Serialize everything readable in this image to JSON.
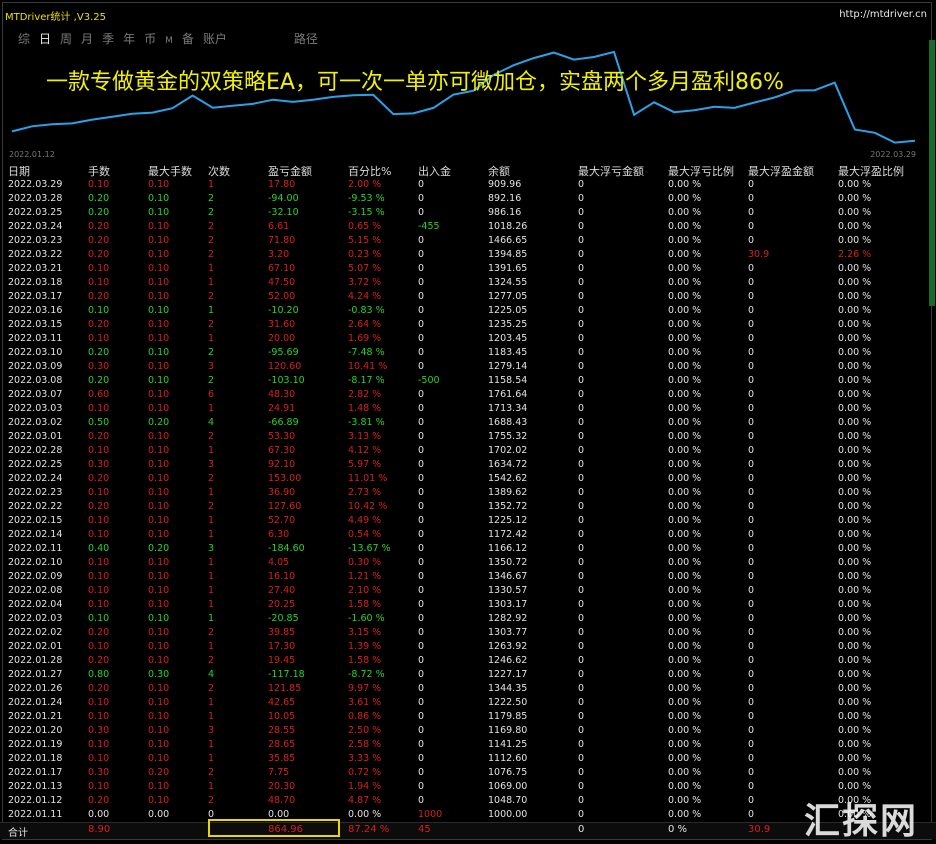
{
  "app": {
    "title": "MTDriver统计 ,V3.25",
    "url": "http://mtdriver.cn"
  },
  "tabs": [
    {
      "label": "综",
      "active": false
    },
    {
      "label": "日",
      "active": true
    },
    {
      "label": "周",
      "active": false
    },
    {
      "label": "月",
      "active": false
    },
    {
      "label": "季",
      "active": false
    },
    {
      "label": "年",
      "active": false
    },
    {
      "label": "币",
      "active": false
    },
    {
      "label": "M",
      "active": false
    },
    {
      "label": "备",
      "active": false
    },
    {
      "label": "账户",
      "active": false
    },
    {
      "label": "路径",
      "active": false
    }
  ],
  "headline": "一款专做黄金的双策略EA，可一次一单亦可微加仓，实盘两个多月盈利86%",
  "chart_dates": {
    "start": "2022.01.12",
    "end": "2022.03.29"
  },
  "colors": {
    "profit": "#d42020",
    "loss": "#28d228",
    "headline": "#f2f200",
    "line": "#2aa2e8"
  },
  "chart_data": {
    "type": "line",
    "title": "",
    "xlabel": "",
    "ylabel": "",
    "x": [
      "2022.01.11",
      "2022.01.12",
      "2022.01.13",
      "2022.01.17",
      "2022.01.18",
      "2022.01.19",
      "2022.01.20",
      "2022.01.21",
      "2022.01.24",
      "2022.01.26",
      "2022.01.27",
      "2022.01.28",
      "2022.02.01",
      "2022.02.02",
      "2022.02.03",
      "2022.02.04",
      "2022.02.08",
      "2022.02.09",
      "2022.02.10",
      "2022.02.11",
      "2022.02.14",
      "2022.02.15",
      "2022.02.22",
      "2022.02.23",
      "2022.02.24",
      "2022.02.25",
      "2022.02.28",
      "2022.03.01",
      "2022.03.02",
      "2022.03.03",
      "2022.03.07",
      "2022.03.08",
      "2022.03.09",
      "2022.03.10",
      "2022.03.11",
      "2022.03.15",
      "2022.03.16",
      "2022.03.17",
      "2022.03.18",
      "2022.03.21",
      "2022.03.22",
      "2022.03.23",
      "2022.03.24",
      "2022.03.25",
      "2022.03.28",
      "2022.03.29"
    ],
    "series": [
      {
        "values": [
          1000.0,
          1048.7,
          1069.0,
          1076.75,
          1112.6,
          1141.25,
          1169.8,
          1179.85,
          1222.5,
          1344.35,
          1227.17,
          1246.62,
          1263.92,
          1303.77,
          1282.92,
          1303.17,
          1330.57,
          1346.67,
          1350.72,
          1166.12,
          1172.42,
          1225.12,
          1352.72,
          1389.62,
          1542.62,
          1634.72,
          1702.02,
          1755.32,
          1688.43,
          1713.34,
          1761.64,
          1158.54,
          1279.14,
          1183.45,
          1203.45,
          1235.25,
          1225.05,
          1277.05,
          1324.55,
          1391.65,
          1394.85,
          1466.65,
          1018.26,
          986.16,
          892.16,
          909.96
        ]
      }
    ]
  },
  "table": {
    "headers": [
      "日期",
      "手数",
      "最大手数",
      "次数",
      "盈亏金额",
      "百分比%",
      "出入金",
      "余额",
      "最大浮亏金额",
      "最大浮亏比例",
      "最大浮盈金额",
      "最大浮盈比例"
    ],
    "rows": [
      [
        "2022.03.29",
        "0.10",
        "0.10",
        "1",
        "17.80",
        "2.00 %",
        "0",
        "909.96",
        "0",
        "0.00 %",
        "0",
        "0.00 %"
      ],
      [
        "2022.03.28",
        "0.20",
        "0.10",
        "2",
        "-94.00",
        "-9.53 %",
        "0",
        "892.16",
        "0",
        "0.00 %",
        "0",
        "0.00 %"
      ],
      [
        "2022.03.25",
        "0.20",
        "0.10",
        "2",
        "-32.10",
        "-3.15 %",
        "0",
        "986.16",
        "0",
        "0.00 %",
        "0",
        "0.00 %"
      ],
      [
        "2022.03.24",
        "0.20",
        "0.10",
        "2",
        "6.61",
        "0.65 %",
        "-455",
        "1018.26",
        "0",
        "0.00 %",
        "0",
        "0.00 %"
      ],
      [
        "2022.03.23",
        "0.20",
        "0.10",
        "2",
        "71.80",
        "5.15 %",
        "0",
        "1466.65",
        "0",
        "0.00 %",
        "0",
        "0.00 %"
      ],
      [
        "2022.03.22",
        "0.20",
        "0.10",
        "2",
        "3.20",
        "0.23 %",
        "0",
        "1394.85",
        "0",
        "0.00 %",
        "30.9",
        "2.26 %"
      ],
      [
        "2022.03.21",
        "0.10",
        "0.10",
        "1",
        "67.10",
        "5.07 %",
        "0",
        "1391.65",
        "0",
        "0.00 %",
        "0",
        "0.00 %"
      ],
      [
        "2022.03.18",
        "0.10",
        "0.10",
        "1",
        "47.50",
        "3.72 %",
        "0",
        "1324.55",
        "0",
        "0.00 %",
        "0",
        "0.00 %"
      ],
      [
        "2022.03.17",
        "0.20",
        "0.10",
        "2",
        "52.00",
        "4.24 %",
        "0",
        "1277.05",
        "0",
        "0.00 %",
        "0",
        "0.00 %"
      ],
      [
        "2022.03.16",
        "0.10",
        "0.10",
        "1",
        "-10.20",
        "-0.83 %",
        "0",
        "1225.05",
        "0",
        "0.00 %",
        "0",
        "0.00 %"
      ],
      [
        "2022.03.15",
        "0.20",
        "0.10",
        "2",
        "31.60",
        "2.64 %",
        "0",
        "1235.25",
        "0",
        "0.00 %",
        "0",
        "0.00 %"
      ],
      [
        "2022.03.11",
        "0.10",
        "0.10",
        "1",
        "20.00",
        "1.69 %",
        "0",
        "1203.45",
        "0",
        "0.00 %",
        "0",
        "0.00 %"
      ],
      [
        "2022.03.10",
        "0.20",
        "0.10",
        "2",
        "-95.69",
        "-7.48 %",
        "0",
        "1183.45",
        "0",
        "0.00 %",
        "0",
        "0.00 %"
      ],
      [
        "2022.03.09",
        "0.30",
        "0.10",
        "3",
        "120.60",
        "10.41 %",
        "0",
        "1279.14",
        "0",
        "0.00 %",
        "0",
        "0.00 %"
      ],
      [
        "2022.03.08",
        "0.20",
        "0.10",
        "2",
        "-103.10",
        "-8.17 %",
        "-500",
        "1158.54",
        "0",
        "0.00 %",
        "0",
        "0.00 %"
      ],
      [
        "2022.03.07",
        "0.60",
        "0.10",
        "6",
        "48.30",
        "2.82 %",
        "0",
        "1761.64",
        "0",
        "0.00 %",
        "0",
        "0.00 %"
      ],
      [
        "2022.03.03",
        "0.10",
        "0.10",
        "1",
        "24.91",
        "1.48 %",
        "0",
        "1713.34",
        "0",
        "0.00 %",
        "0",
        "0.00 %"
      ],
      [
        "2022.03.02",
        "0.50",
        "0.20",
        "4",
        "-66.89",
        "-3.81 %",
        "0",
        "1688.43",
        "0",
        "0.00 %",
        "0",
        "0.00 %"
      ],
      [
        "2022.03.01",
        "0.20",
        "0.10",
        "2",
        "53.30",
        "3.13 %",
        "0",
        "1755.32",
        "0",
        "0.00 %",
        "0",
        "0.00 %"
      ],
      [
        "2022.02.28",
        "0.10",
        "0.10",
        "1",
        "67.30",
        "4.12 %",
        "0",
        "1702.02",
        "0",
        "0.00 %",
        "0",
        "0.00 %"
      ],
      [
        "2022.02.25",
        "0.30",
        "0.10",
        "3",
        "92.10",
        "5.97 %",
        "0",
        "1634.72",
        "0",
        "0.00 %",
        "0",
        "0.00 %"
      ],
      [
        "2022.02.24",
        "0.20",
        "0.10",
        "2",
        "153.00",
        "11.01 %",
        "0",
        "1542.62",
        "0",
        "0.00 %",
        "0",
        "0.00 %"
      ],
      [
        "2022.02.23",
        "0.10",
        "0.10",
        "1",
        "36.90",
        "2.73 %",
        "0",
        "1389.62",
        "0",
        "0.00 %",
        "0",
        "0.00 %"
      ],
      [
        "2022.02.22",
        "0.20",
        "0.10",
        "2",
        "127.60",
        "10.42 %",
        "0",
        "1352.72",
        "0",
        "0.00 %",
        "0",
        "0.00 %"
      ],
      [
        "2022.02.15",
        "0.10",
        "0.10",
        "1",
        "52.70",
        "4.49 %",
        "0",
        "1225.12",
        "0",
        "0.00 %",
        "0",
        "0.00 %"
      ],
      [
        "2022.02.14",
        "0.10",
        "0.10",
        "1",
        "6.30",
        "0.54 %",
        "0",
        "1172.42",
        "0",
        "0.00 %",
        "0",
        "0.00 %"
      ],
      [
        "2022.02.11",
        "0.40",
        "0.20",
        "3",
        "-184.60",
        "-13.67 %",
        "0",
        "1166.12",
        "0",
        "0.00 %",
        "0",
        "0.00 %"
      ],
      [
        "2022.02.10",
        "0.10",
        "0.10",
        "1",
        "4.05",
        "0.30 %",
        "0",
        "1350.72",
        "0",
        "0.00 %",
        "0",
        "0.00 %"
      ],
      [
        "2022.02.09",
        "0.10",
        "0.10",
        "1",
        "16.10",
        "1.21 %",
        "0",
        "1346.67",
        "0",
        "0.00 %",
        "0",
        "0.00 %"
      ],
      [
        "2022.02.08",
        "0.10",
        "0.10",
        "1",
        "27.40",
        "2.10 %",
        "0",
        "1330.57",
        "0",
        "0.00 %",
        "0",
        "0.00 %"
      ],
      [
        "2022.02.04",
        "0.10",
        "0.10",
        "1",
        "20.25",
        "1.58 %",
        "0",
        "1303.17",
        "0",
        "0.00 %",
        "0",
        "0.00 %"
      ],
      [
        "2022.02.03",
        "0.10",
        "0.10",
        "1",
        "-20.85",
        "-1.60 %",
        "0",
        "1282.92",
        "0",
        "0.00 %",
        "0",
        "0.00 %"
      ],
      [
        "2022.02.02",
        "0.20",
        "0.10",
        "2",
        "39.85",
        "3.15 %",
        "0",
        "1303.77",
        "0",
        "0.00 %",
        "0",
        "0.00 %"
      ],
      [
        "2022.02.01",
        "0.10",
        "0.10",
        "1",
        "17.30",
        "1.39 %",
        "0",
        "1263.92",
        "0",
        "0.00 %",
        "0",
        "0.00 %"
      ],
      [
        "2022.01.28",
        "0.20",
        "0.10",
        "2",
        "19.45",
        "1.58 %",
        "0",
        "1246.62",
        "0",
        "0.00 %",
        "0",
        "0.00 %"
      ],
      [
        "2022.01.27",
        "0.80",
        "0.30",
        "4",
        "-117.18",
        "-8.72 %",
        "0",
        "1227.17",
        "0",
        "0.00 %",
        "0",
        "0.00 %"
      ],
      [
        "2022.01.26",
        "0.20",
        "0.10",
        "2",
        "121.85",
        "9.97 %",
        "0",
        "1344.35",
        "0",
        "0.00 %",
        "0",
        "0.00 %"
      ],
      [
        "2022.01.24",
        "0.10",
        "0.10",
        "1",
        "42.65",
        "3.61 %",
        "0",
        "1222.50",
        "0",
        "0.00 %",
        "0",
        "0.00 %"
      ],
      [
        "2022.01.21",
        "0.10",
        "0.10",
        "1",
        "10.05",
        "0.86 %",
        "0",
        "1179.85",
        "0",
        "0.00 %",
        "0",
        "0.00 %"
      ],
      [
        "2022.01.20",
        "0.30",
        "0.10",
        "3",
        "28.55",
        "2.50 %",
        "0",
        "1169.80",
        "0",
        "0.00 %",
        "0",
        "0.00 %"
      ],
      [
        "2022.01.19",
        "0.10",
        "0.10",
        "1",
        "28.65",
        "2.58 %",
        "0",
        "1141.25",
        "0",
        "0.00 %",
        "0",
        "0.00 %"
      ],
      [
        "2022.01.18",
        "0.10",
        "0.10",
        "1",
        "35.85",
        "3.33 %",
        "0",
        "1112.60",
        "0",
        "0.00 %",
        "0",
        "0.00 %"
      ],
      [
        "2022.01.17",
        "0.30",
        "0.20",
        "2",
        "7.75",
        "0.72 %",
        "0",
        "1076.75",
        "0",
        "0.00 %",
        "0",
        "0.00 %"
      ],
      [
        "2022.01.13",
        "0.10",
        "0.10",
        "1",
        "20.30",
        "1.94 %",
        "0",
        "1069.00",
        "0",
        "0.00 %",
        "0",
        "0.00 %"
      ],
      [
        "2022.01.12",
        "0.20",
        "0.10",
        "2",
        "48.70",
        "4.87 %",
        "0",
        "1048.70",
        "0",
        "0.00 %",
        "0",
        "0.00 %"
      ],
      [
        "2022.01.11",
        "0.00",
        "0.00",
        "0",
        "0.00",
        "0.00 %",
        "1000",
        "1000.00",
        "0",
        "0.00 %",
        "0",
        "0.00 %"
      ]
    ],
    "total": [
      "合计",
      "8.90",
      "",
      "",
      "864.96",
      "87.24 %",
      "45",
      "",
      "0",
      "0 %",
      "30.9",
      ""
    ]
  },
  "watermark": "汇探网"
}
